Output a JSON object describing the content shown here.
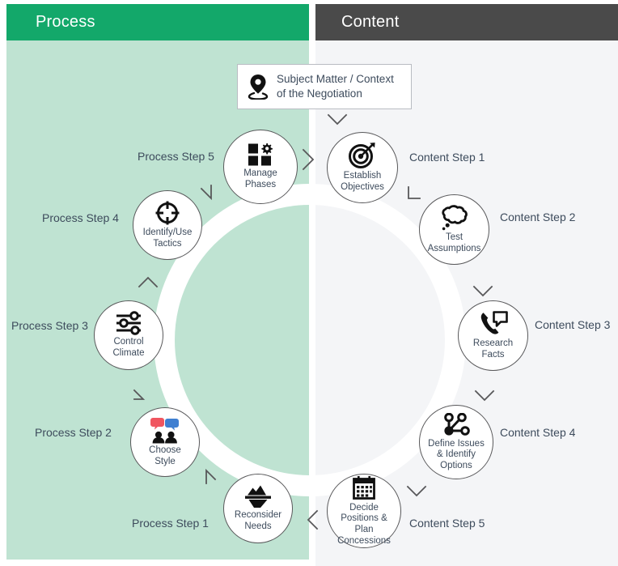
{
  "panels": {
    "process": {
      "title": "Process",
      "color": "#13a86a",
      "body_color": "#bfe3d2"
    },
    "content": {
      "title": "Content",
      "color": "#4a4a4a",
      "body_color": "#f4f5f7"
    }
  },
  "subject_box": {
    "icon": "location-pin-icon",
    "line1": "Subject Matter / Context",
    "line2": "of the Negotiation",
    "text": "Subject Matter / Context\nof the Negotiation"
  },
  "nodes": [
    {
      "id": "manage-phases",
      "side": "process",
      "icon": "grid-gear-icon",
      "label": "Manage\nPhases",
      "caption": "Process Step 5"
    },
    {
      "id": "identify-use-tactics",
      "side": "process",
      "icon": "crosshair-icon",
      "label": "Identify/Use\nTactics",
      "caption": "Process Step 4"
    },
    {
      "id": "control-climate",
      "side": "process",
      "icon": "sliders-icon",
      "label": "Control\nClimate",
      "caption": "Process Step 3"
    },
    {
      "id": "choose-style",
      "side": "process",
      "icon": "people-speech-bubbles-icon",
      "label": "Choose\nStyle",
      "caption": "Process Step 2"
    },
    {
      "id": "reconsider-needs",
      "side": "process",
      "icon": "iceberg-icon",
      "label": "Reconsider\nNeeds",
      "caption": "Process Step 1"
    },
    {
      "id": "establish-objectives",
      "side": "content",
      "icon": "target-dart-icon",
      "label": "Establish\nObjectives",
      "caption": "Content Step 1"
    },
    {
      "id": "test-assumptions",
      "side": "content",
      "icon": "thought-cloud-icon",
      "label": "Test\nAssumptions",
      "caption": "Content Step 2"
    },
    {
      "id": "research-facts",
      "side": "content",
      "icon": "phone-chat-icon",
      "label": "Research\nFacts",
      "caption": "Content Step 3"
    },
    {
      "id": "define-issues",
      "side": "content",
      "icon": "node-network-icon",
      "label": "Define Issues\n& Identify\nOptions",
      "caption": "Content Step 4"
    },
    {
      "id": "decide-positions",
      "side": "content",
      "icon": "calendar-icon",
      "label": "Decide\nPositions & Plan\nConcessions",
      "caption": "Content Step 5"
    }
  ],
  "accents": {
    "speech_bubble_red": "#f0555f",
    "speech_bubble_blue": "#3f7fd1",
    "ribbon": "#ffffff",
    "chevron": "#58585a",
    "text": "#3d4b5c"
  }
}
